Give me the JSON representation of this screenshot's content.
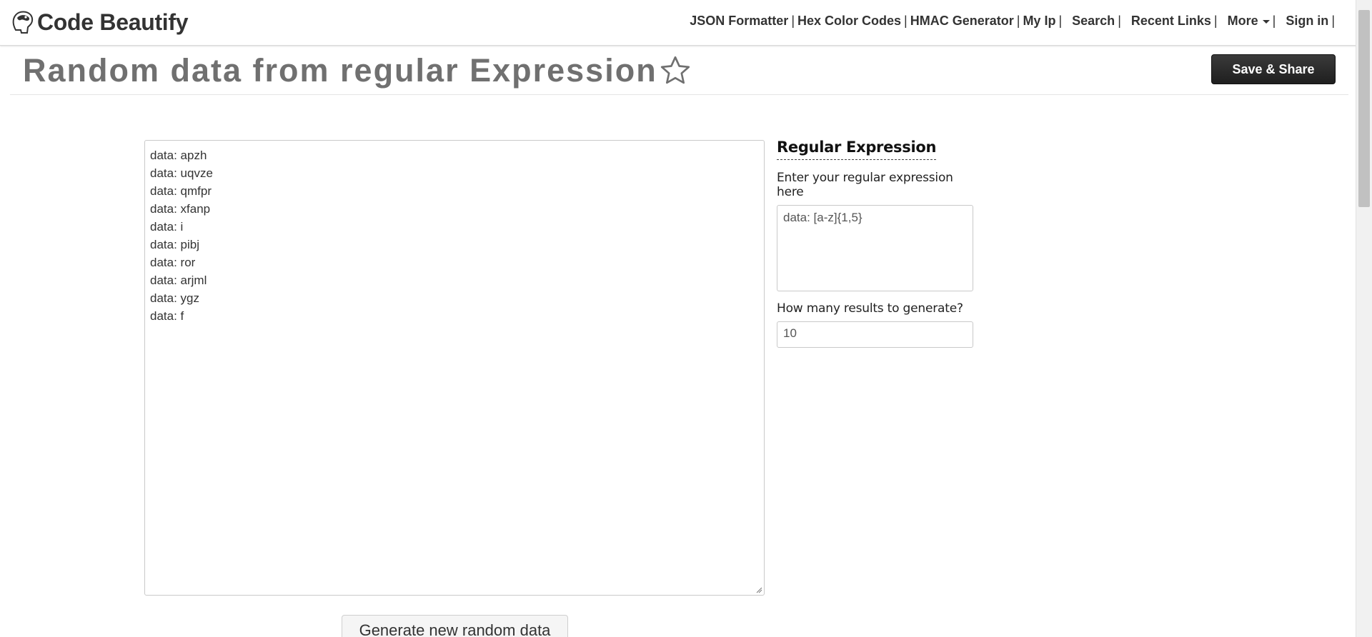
{
  "header": {
    "logo_text": "Code Beautify",
    "nav": [
      {
        "label": "JSON Formatter",
        "name": "nav-json-formatter"
      },
      {
        "label": "Hex Color Codes",
        "name": "nav-hex-color-codes"
      },
      {
        "label": "HMAC Generator",
        "name": "nav-hmac-generator"
      },
      {
        "label": "My Ip",
        "name": "nav-my-ip"
      },
      {
        "label": "Search",
        "name": "nav-search"
      },
      {
        "label": "Recent Links",
        "name": "nav-recent-links"
      },
      {
        "label": "More",
        "name": "nav-more",
        "dropdown": true
      },
      {
        "label": "Sign in",
        "name": "nav-sign-in"
      }
    ],
    "separator": "|"
  },
  "page": {
    "title": "Random data from regular Expression",
    "save_share_label": "Save & Share",
    "generate_label": "Generate new random data"
  },
  "output": {
    "lines": [
      "data: apzh",
      "data: uqvze",
      "data: qmfpr",
      "data: xfanp",
      "data: i",
      "data: pibj",
      "data: ror",
      "data: arjml",
      "data: ygz",
      "data: f"
    ]
  },
  "side_panel": {
    "heading": "Regular Expression",
    "regex_label": "Enter your regular expression here",
    "regex_value": "data: [a-z]{1,5}",
    "count_label": "How many results to generate?",
    "count_value": "10"
  },
  "colors": {
    "title_gray": "#707070",
    "button_dark": "#2a2a2a",
    "text_dark": "#333333"
  },
  "icons": {
    "favorite": "star-outline-icon",
    "logo": "code-beautify-logo-icon",
    "more_dropdown": "caret-down-icon",
    "resize": "resize-grip-icon"
  }
}
